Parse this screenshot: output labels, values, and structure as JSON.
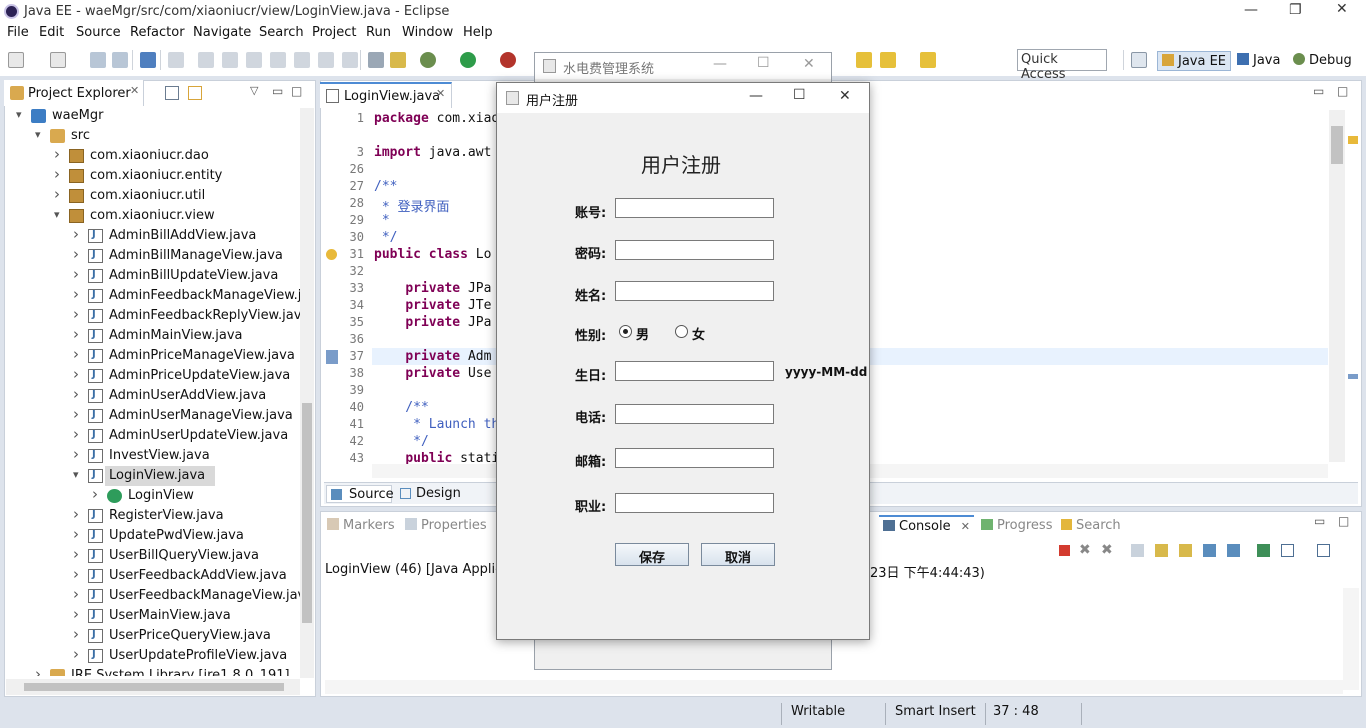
{
  "window": {
    "title": "Java EE - waeMgr/src/com/xiaoniucr/view/LoginView.java - Eclipse"
  },
  "menu": [
    "File",
    "Edit",
    "Source",
    "Refactor",
    "Navigate",
    "Search",
    "Project",
    "Run",
    "Window",
    "Help"
  ],
  "toolbar": {
    "quick_access": "Quick Access",
    "perspectives": [
      "Java EE",
      "Java",
      "Debug"
    ]
  },
  "project_explorer": {
    "tab_label": "Project Explorer",
    "tree": [
      {
        "label": "waeMgr",
        "level": 0,
        "expanded": true,
        "icon": "project-icon"
      },
      {
        "label": "src",
        "level": 1,
        "expanded": true,
        "icon": "source-folder-icon"
      },
      {
        "label": "com.xiaoniucr.dao",
        "level": 2,
        "expanded": false,
        "icon": "package-icon"
      },
      {
        "label": "com.xiaoniucr.entity",
        "level": 2,
        "expanded": false,
        "icon": "package-icon"
      },
      {
        "label": "com.xiaoniucr.util",
        "level": 2,
        "expanded": false,
        "icon": "package-icon"
      },
      {
        "label": "com.xiaoniucr.view",
        "level": 2,
        "expanded": true,
        "icon": "package-icon"
      },
      {
        "label": "AdminBillAddView.java",
        "level": 3,
        "expanded": false,
        "icon": "java-file-icon"
      },
      {
        "label": "AdminBillManageView.java",
        "level": 3,
        "expanded": false,
        "icon": "java-file-icon"
      },
      {
        "label": "AdminBillUpdateView.java",
        "level": 3,
        "expanded": false,
        "icon": "java-file-icon"
      },
      {
        "label": "AdminFeedbackManageView.java",
        "level": 3,
        "expanded": false,
        "icon": "java-file-icon"
      },
      {
        "label": "AdminFeedbackReplyView.java",
        "level": 3,
        "expanded": false,
        "icon": "java-file-icon"
      },
      {
        "label": "AdminMainView.java",
        "level": 3,
        "expanded": false,
        "icon": "java-file-icon"
      },
      {
        "label": "AdminPriceManageView.java",
        "level": 3,
        "expanded": false,
        "icon": "java-file-icon"
      },
      {
        "label": "AdminPriceUpdateView.java",
        "level": 3,
        "expanded": false,
        "icon": "java-file-icon"
      },
      {
        "label": "AdminUserAddView.java",
        "level": 3,
        "expanded": false,
        "icon": "java-file-icon"
      },
      {
        "label": "AdminUserManageView.java",
        "level": 3,
        "expanded": false,
        "icon": "java-file-icon"
      },
      {
        "label": "AdminUserUpdateView.java",
        "level": 3,
        "expanded": false,
        "icon": "java-file-icon"
      },
      {
        "label": "InvestView.java",
        "level": 3,
        "expanded": false,
        "icon": "java-file-icon"
      },
      {
        "label": "LoginView.java",
        "level": 3,
        "expanded": true,
        "icon": "java-file-icon",
        "selected": true
      },
      {
        "label": "LoginView",
        "level": 4,
        "expanded": false,
        "icon": "class-icon"
      },
      {
        "label": "RegisterView.java",
        "level": 3,
        "expanded": false,
        "icon": "java-file-icon"
      },
      {
        "label": "UpdatePwdView.java",
        "level": 3,
        "expanded": false,
        "icon": "java-file-icon"
      },
      {
        "label": "UserBillQueryView.java",
        "level": 3,
        "expanded": false,
        "icon": "java-file-icon"
      },
      {
        "label": "UserFeedbackAddView.java",
        "level": 3,
        "expanded": false,
        "icon": "java-file-icon"
      },
      {
        "label": "UserFeedbackManageView.java",
        "level": 3,
        "expanded": false,
        "icon": "java-file-icon"
      },
      {
        "label": "UserMainView.java",
        "level": 3,
        "expanded": false,
        "icon": "java-file-icon"
      },
      {
        "label": "UserPriceQueryView.java",
        "level": 3,
        "expanded": false,
        "icon": "java-file-icon"
      },
      {
        "label": "UserUpdateProfileView.java",
        "level": 3,
        "expanded": false,
        "icon": "java-file-icon"
      },
      {
        "label": "JRE System Library [jre1.8.0_191]",
        "level": 1,
        "expanded": false,
        "icon": "library-icon"
      }
    ]
  },
  "editor": {
    "tab_label": "LoginView.java",
    "lines": [
      {
        "n": "1",
        "code": "package com.xiao"
      },
      {
        "n": "",
        "code": ""
      },
      {
        "n": "3",
        "code": "import java.awt"
      },
      {
        "n": "26",
        "code": ""
      },
      {
        "n": "27",
        "code": "/**"
      },
      {
        "n": "28",
        "code": " * 登录界面"
      },
      {
        "n": "29",
        "code": " *"
      },
      {
        "n": "30",
        "code": " */"
      },
      {
        "n": "31",
        "code": "public class Lo"
      },
      {
        "n": "32",
        "code": ""
      },
      {
        "n": "33",
        "code": "    private JPa"
      },
      {
        "n": "34",
        "code": "    private JTe"
      },
      {
        "n": "35",
        "code": "    private JPa"
      },
      {
        "n": "36",
        "code": ""
      },
      {
        "n": "37",
        "code": "    private Adm"
      },
      {
        "n": "38",
        "code": "    private Use"
      },
      {
        "n": "39",
        "code": ""
      },
      {
        "n": "40",
        "code": "    /**"
      },
      {
        "n": "41",
        "code": "     * Launch th"
      },
      {
        "n": "42",
        "code": "     */"
      },
      {
        "n": "43",
        "code": "    public stati"
      }
    ],
    "bottom_tabs": [
      "Source",
      "Design"
    ]
  },
  "bottom_panel": {
    "tabs_left": [
      "Markers",
      "Properties"
    ],
    "tabs_right": [
      "Console",
      "Progress",
      "Search"
    ],
    "console_left": "LoginView (46) [Java Applicati",
    "console_right": "23日 下午4:44:43)"
  },
  "status": {
    "writable": "Writable",
    "insert_mode": "Smart Insert",
    "position": "37 : 48"
  },
  "background_window": {
    "title": "水电费管理系统"
  },
  "dialog": {
    "title": "用户注册",
    "heading": "用户注册",
    "fields": {
      "account": {
        "label": "账号:",
        "value": ""
      },
      "password": {
        "label": "密码:",
        "value": ""
      },
      "name": {
        "label": "姓名:",
        "value": ""
      },
      "gender": {
        "label": "性别:",
        "options": [
          "男",
          "女"
        ],
        "selected": "男"
      },
      "birthday": {
        "label": "生日:",
        "value": "",
        "hint": "yyyy-MM-dd"
      },
      "phone": {
        "label": "电话:",
        "value": ""
      },
      "email": {
        "label": "邮箱:",
        "value": ""
      },
      "job": {
        "label": "职业:",
        "value": ""
      }
    },
    "save_label": "保存",
    "cancel_label": "取消"
  }
}
